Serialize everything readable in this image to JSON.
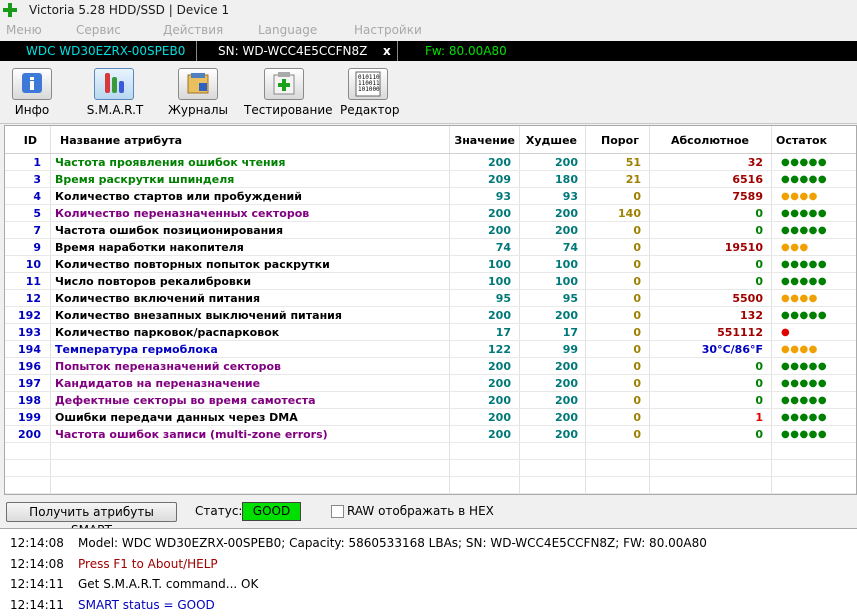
{
  "window": {
    "title": "Victoria 5.28 HDD/SSD | Device 1"
  },
  "menu": [
    "Меню",
    "Сервис",
    "Действия",
    "Language",
    "Настройки"
  ],
  "drive": {
    "model": "WDC WD30EZRX-00SPEB0",
    "serial": "SN: WD-WCC4E5CCFN8Z",
    "close": "x",
    "firmware": "Fw: 80.00A80"
  },
  "toolbar": [
    {
      "label": "Инфо",
      "icon": "info-icon"
    },
    {
      "label": "S.M.A.R.T",
      "icon": "smart-icon"
    },
    {
      "label": "Журналы",
      "icon": "logs-icon"
    },
    {
      "label": "Тестирование",
      "icon": "test-icon"
    },
    {
      "label": "Редактор",
      "icon": "editor-icon"
    }
  ],
  "table": {
    "headers": {
      "id": "ID",
      "name": "Название атрибута",
      "value": "Значение",
      "worst": "Худшее",
      "threshold": "Порог",
      "raw": "Абсолютное",
      "remaining": "Остаток"
    },
    "rows": [
      {
        "id": "1",
        "name": "Частота проявления ошибок чтения",
        "value": "200",
        "worst": "200",
        "threshold": "51",
        "raw": "32",
        "remaining": "●●●●●",
        "name_color": "#008000",
        "raw_color": "#a00000",
        "rem_color": "#008000"
      },
      {
        "id": "3",
        "name": "Время раскрутки шпинделя",
        "value": "209",
        "worst": "180",
        "threshold": "21",
        "raw": "6516",
        "remaining": "●●●●●",
        "name_color": "#008000",
        "raw_color": "#a00000",
        "rem_color": "#008000"
      },
      {
        "id": "4",
        "name": "Количество стартов или пробуждений",
        "value": "93",
        "worst": "93",
        "threshold": "0",
        "raw": "7589",
        "remaining": "●●●●",
        "name_color": "#000000",
        "raw_color": "#a00000",
        "rem_color": "#f0a000"
      },
      {
        "id": "5",
        "name": "Количество переназначенных секторов",
        "value": "200",
        "worst": "200",
        "threshold": "140",
        "raw": "0",
        "remaining": "●●●●●",
        "name_color": "#800080",
        "raw_color": "#008000",
        "rem_color": "#008000"
      },
      {
        "id": "7",
        "name": "Частота ошибок позиционирования",
        "value": "200",
        "worst": "200",
        "threshold": "0",
        "raw": "0",
        "remaining": "●●●●●",
        "name_color": "#000000",
        "raw_color": "#008000",
        "rem_color": "#008000"
      },
      {
        "id": "9",
        "name": "Время наработки накопителя",
        "value": "74",
        "worst": "74",
        "threshold": "0",
        "raw": "19510",
        "remaining": "●●●",
        "name_color": "#000000",
        "raw_color": "#a00000",
        "rem_color": "#f0a000"
      },
      {
        "id": "10",
        "name": "Количество повторных попыток раскрутки",
        "value": "100",
        "worst": "100",
        "threshold": "0",
        "raw": "0",
        "remaining": "●●●●●",
        "name_color": "#000000",
        "raw_color": "#008000",
        "rem_color": "#008000"
      },
      {
        "id": "11",
        "name": "Число повторов рекалибровки",
        "value": "100",
        "worst": "100",
        "threshold": "0",
        "raw": "0",
        "remaining": "●●●●●",
        "name_color": "#000000",
        "raw_color": "#008000",
        "rem_color": "#008000"
      },
      {
        "id": "12",
        "name": "Количество включений питания",
        "value": "95",
        "worst": "95",
        "threshold": "0",
        "raw": "5500",
        "remaining": "●●●●",
        "name_color": "#000000",
        "raw_color": "#a00000",
        "rem_color": "#f0a000"
      },
      {
        "id": "192",
        "name": "Количество внезапных выключений питания",
        "value": "200",
        "worst": "200",
        "threshold": "0",
        "raw": "132",
        "remaining": "●●●●●",
        "name_color": "#000000",
        "raw_color": "#a00000",
        "rem_color": "#008000"
      },
      {
        "id": "193",
        "name": "Количество парковок/распарковок",
        "value": "17",
        "worst": "17",
        "threshold": "0",
        "raw": "551112",
        "remaining": "●",
        "name_color": "#000000",
        "raw_color": "#a00000",
        "rem_color": "#e00000"
      },
      {
        "id": "194",
        "name": "Температура гермоблока",
        "value": "122",
        "worst": "99",
        "threshold": "0",
        "raw": "30°C/86°F",
        "remaining": "●●●●",
        "name_color": "#0000c0",
        "raw_color": "#0000c0",
        "rem_color": "#f0a000"
      },
      {
        "id": "196",
        "name": "Попыток переназначений секторов",
        "value": "200",
        "worst": "200",
        "threshold": "0",
        "raw": "0",
        "remaining": "●●●●●",
        "name_color": "#800080",
        "raw_color": "#008000",
        "rem_color": "#008000"
      },
      {
        "id": "197",
        "name": "Кандидатов на переназначение",
        "value": "200",
        "worst": "200",
        "threshold": "0",
        "raw": "0",
        "remaining": "●●●●●",
        "name_color": "#800080",
        "raw_color": "#008000",
        "rem_color": "#008000"
      },
      {
        "id": "198",
        "name": "Дефектные секторы во время самотеста",
        "value": "200",
        "worst": "200",
        "threshold": "0",
        "raw": "0",
        "remaining": "●●●●●",
        "name_color": "#800080",
        "raw_color": "#008000",
        "rem_color": "#008000"
      },
      {
        "id": "199",
        "name": "Ошибки передачи данных через DMA",
        "value": "200",
        "worst": "200",
        "threshold": "0",
        "raw": "1",
        "remaining": "●●●●●",
        "name_color": "#000000",
        "raw_color": "#e00000",
        "rem_color": "#008000"
      },
      {
        "id": "200",
        "name": "Частота ошибок записи (multi-zone errors)",
        "value": "200",
        "worst": "200",
        "threshold": "0",
        "raw": "0",
        "remaining": "●●●●●",
        "name_color": "#800080",
        "raw_color": "#008000",
        "rem_color": "#008000"
      }
    ]
  },
  "status": {
    "button": "Получить атрибуты SMART",
    "label": "Статус:",
    "value": "GOOD",
    "hex_label": "RAW отображать в HEX",
    "value_color": "#00e000"
  },
  "log": [
    {
      "time": "12:14:08",
      "text": "Model: WDC WD30EZRX-00SPEB0; Capacity: 5860533168 LBAs; SN: WD-WCC4E5CCFN8Z; FW: 80.00A80",
      "color": "#000000"
    },
    {
      "time": "12:14:08",
      "text": "Press F1 to About/HELP",
      "color": "#a00000"
    },
    {
      "time": "12:14:11",
      "text": "Get S.M.A.R.T. command... OK",
      "color": "#000000"
    },
    {
      "time": "12:14:11",
      "text": "SMART status = GOOD",
      "color": "#0000c0"
    }
  ]
}
